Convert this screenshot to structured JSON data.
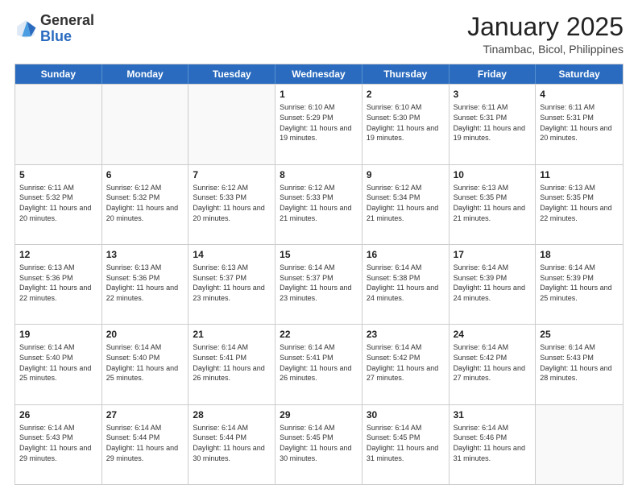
{
  "header": {
    "logo_general": "General",
    "logo_blue": "Blue",
    "month_title": "January 2025",
    "location": "Tinambac, Bicol, Philippines"
  },
  "days_of_week": [
    "Sunday",
    "Monday",
    "Tuesday",
    "Wednesday",
    "Thursday",
    "Friday",
    "Saturday"
  ],
  "weeks": [
    [
      {
        "day": "",
        "sunrise": "",
        "sunset": "",
        "daylight": "",
        "empty": true
      },
      {
        "day": "",
        "sunrise": "",
        "sunset": "",
        "daylight": "",
        "empty": true
      },
      {
        "day": "",
        "sunrise": "",
        "sunset": "",
        "daylight": "",
        "empty": true
      },
      {
        "day": "1",
        "sunrise": "Sunrise: 6:10 AM",
        "sunset": "Sunset: 5:29 PM",
        "daylight": "Daylight: 11 hours and 19 minutes.",
        "empty": false
      },
      {
        "day": "2",
        "sunrise": "Sunrise: 6:10 AM",
        "sunset": "Sunset: 5:30 PM",
        "daylight": "Daylight: 11 hours and 19 minutes.",
        "empty": false
      },
      {
        "day": "3",
        "sunrise": "Sunrise: 6:11 AM",
        "sunset": "Sunset: 5:31 PM",
        "daylight": "Daylight: 11 hours and 19 minutes.",
        "empty": false
      },
      {
        "day": "4",
        "sunrise": "Sunrise: 6:11 AM",
        "sunset": "Sunset: 5:31 PM",
        "daylight": "Daylight: 11 hours and 20 minutes.",
        "empty": false
      }
    ],
    [
      {
        "day": "5",
        "sunrise": "Sunrise: 6:11 AM",
        "sunset": "Sunset: 5:32 PM",
        "daylight": "Daylight: 11 hours and 20 minutes.",
        "empty": false
      },
      {
        "day": "6",
        "sunrise": "Sunrise: 6:12 AM",
        "sunset": "Sunset: 5:32 PM",
        "daylight": "Daylight: 11 hours and 20 minutes.",
        "empty": false
      },
      {
        "day": "7",
        "sunrise": "Sunrise: 6:12 AM",
        "sunset": "Sunset: 5:33 PM",
        "daylight": "Daylight: 11 hours and 20 minutes.",
        "empty": false
      },
      {
        "day": "8",
        "sunrise": "Sunrise: 6:12 AM",
        "sunset": "Sunset: 5:33 PM",
        "daylight": "Daylight: 11 hours and 21 minutes.",
        "empty": false
      },
      {
        "day": "9",
        "sunrise": "Sunrise: 6:12 AM",
        "sunset": "Sunset: 5:34 PM",
        "daylight": "Daylight: 11 hours and 21 minutes.",
        "empty": false
      },
      {
        "day": "10",
        "sunrise": "Sunrise: 6:13 AM",
        "sunset": "Sunset: 5:35 PM",
        "daylight": "Daylight: 11 hours and 21 minutes.",
        "empty": false
      },
      {
        "day": "11",
        "sunrise": "Sunrise: 6:13 AM",
        "sunset": "Sunset: 5:35 PM",
        "daylight": "Daylight: 11 hours and 22 minutes.",
        "empty": false
      }
    ],
    [
      {
        "day": "12",
        "sunrise": "Sunrise: 6:13 AM",
        "sunset": "Sunset: 5:36 PM",
        "daylight": "Daylight: 11 hours and 22 minutes.",
        "empty": false
      },
      {
        "day": "13",
        "sunrise": "Sunrise: 6:13 AM",
        "sunset": "Sunset: 5:36 PM",
        "daylight": "Daylight: 11 hours and 22 minutes.",
        "empty": false
      },
      {
        "day": "14",
        "sunrise": "Sunrise: 6:13 AM",
        "sunset": "Sunset: 5:37 PM",
        "daylight": "Daylight: 11 hours and 23 minutes.",
        "empty": false
      },
      {
        "day": "15",
        "sunrise": "Sunrise: 6:14 AM",
        "sunset": "Sunset: 5:37 PM",
        "daylight": "Daylight: 11 hours and 23 minutes.",
        "empty": false
      },
      {
        "day": "16",
        "sunrise": "Sunrise: 6:14 AM",
        "sunset": "Sunset: 5:38 PM",
        "daylight": "Daylight: 11 hours and 24 minutes.",
        "empty": false
      },
      {
        "day": "17",
        "sunrise": "Sunrise: 6:14 AM",
        "sunset": "Sunset: 5:39 PM",
        "daylight": "Daylight: 11 hours and 24 minutes.",
        "empty": false
      },
      {
        "day": "18",
        "sunrise": "Sunrise: 6:14 AM",
        "sunset": "Sunset: 5:39 PM",
        "daylight": "Daylight: 11 hours and 25 minutes.",
        "empty": false
      }
    ],
    [
      {
        "day": "19",
        "sunrise": "Sunrise: 6:14 AM",
        "sunset": "Sunset: 5:40 PM",
        "daylight": "Daylight: 11 hours and 25 minutes.",
        "empty": false
      },
      {
        "day": "20",
        "sunrise": "Sunrise: 6:14 AM",
        "sunset": "Sunset: 5:40 PM",
        "daylight": "Daylight: 11 hours and 25 minutes.",
        "empty": false
      },
      {
        "day": "21",
        "sunrise": "Sunrise: 6:14 AM",
        "sunset": "Sunset: 5:41 PM",
        "daylight": "Daylight: 11 hours and 26 minutes.",
        "empty": false
      },
      {
        "day": "22",
        "sunrise": "Sunrise: 6:14 AM",
        "sunset": "Sunset: 5:41 PM",
        "daylight": "Daylight: 11 hours and 26 minutes.",
        "empty": false
      },
      {
        "day": "23",
        "sunrise": "Sunrise: 6:14 AM",
        "sunset": "Sunset: 5:42 PM",
        "daylight": "Daylight: 11 hours and 27 minutes.",
        "empty": false
      },
      {
        "day": "24",
        "sunrise": "Sunrise: 6:14 AM",
        "sunset": "Sunset: 5:42 PM",
        "daylight": "Daylight: 11 hours and 27 minutes.",
        "empty": false
      },
      {
        "day": "25",
        "sunrise": "Sunrise: 6:14 AM",
        "sunset": "Sunset: 5:43 PM",
        "daylight": "Daylight: 11 hours and 28 minutes.",
        "empty": false
      }
    ],
    [
      {
        "day": "26",
        "sunrise": "Sunrise: 6:14 AM",
        "sunset": "Sunset: 5:43 PM",
        "daylight": "Daylight: 11 hours and 29 minutes.",
        "empty": false
      },
      {
        "day": "27",
        "sunrise": "Sunrise: 6:14 AM",
        "sunset": "Sunset: 5:44 PM",
        "daylight": "Daylight: 11 hours and 29 minutes.",
        "empty": false
      },
      {
        "day": "28",
        "sunrise": "Sunrise: 6:14 AM",
        "sunset": "Sunset: 5:44 PM",
        "daylight": "Daylight: 11 hours and 30 minutes.",
        "empty": false
      },
      {
        "day": "29",
        "sunrise": "Sunrise: 6:14 AM",
        "sunset": "Sunset: 5:45 PM",
        "daylight": "Daylight: 11 hours and 30 minutes.",
        "empty": false
      },
      {
        "day": "30",
        "sunrise": "Sunrise: 6:14 AM",
        "sunset": "Sunset: 5:45 PM",
        "daylight": "Daylight: 11 hours and 31 minutes.",
        "empty": false
      },
      {
        "day": "31",
        "sunrise": "Sunrise: 6:14 AM",
        "sunset": "Sunset: 5:46 PM",
        "daylight": "Daylight: 11 hours and 31 minutes.",
        "empty": false
      },
      {
        "day": "",
        "sunrise": "",
        "sunset": "",
        "daylight": "",
        "empty": true
      }
    ]
  ]
}
